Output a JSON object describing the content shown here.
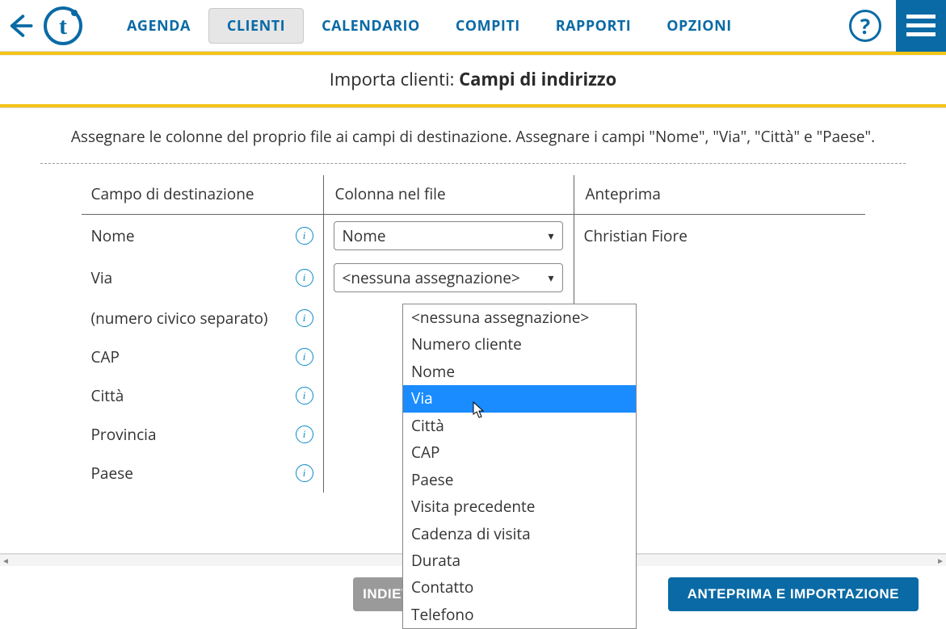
{
  "nav": {
    "items": [
      {
        "label": "AGENDA"
      },
      {
        "label": "CLIENTI"
      },
      {
        "label": "CALENDARIO"
      },
      {
        "label": "COMPITI"
      },
      {
        "label": "RAPPORTI"
      },
      {
        "label": "OPZIONI"
      }
    ],
    "active_index": 1,
    "help_glyph": "?"
  },
  "page_title": {
    "prefix": "Importa clienti: ",
    "main": "Campi di indirizzo"
  },
  "instruction": "Assegnare le colonne del proprio file ai campi di destinazione. Assegnare i campi \"Nome\", \"Via\", \"Città\" e \"Paese\".",
  "table": {
    "headers": {
      "dest": "Campo di destinazione",
      "col": "Colonna nel file",
      "preview": "Anteprima"
    },
    "rows": [
      {
        "dest": "Nome",
        "select_value": "Nome",
        "preview": "Christian Fiore"
      },
      {
        "dest": "Via",
        "select_value": "<nessuna assegnazione>",
        "preview": ""
      },
      {
        "dest": "(numero civico separato)",
        "select_value": "",
        "preview": ""
      },
      {
        "dest": "CAP",
        "select_value": "",
        "preview": ""
      },
      {
        "dest": "Città",
        "select_value": "",
        "preview": ""
      },
      {
        "dest": "Provincia",
        "select_value": "",
        "preview": ""
      },
      {
        "dest": "Paese",
        "select_value": "",
        "preview": ""
      }
    ]
  },
  "dropdown": {
    "options": [
      "<nessuna assegnazione>",
      "Numero cliente",
      "Nome",
      "Via",
      "Città",
      "CAP",
      "Paese",
      "Visita precedente",
      "Cadenza di visita",
      "Durata",
      "Contatto",
      "Telefono"
    ],
    "selected_index": 3
  },
  "footer": {
    "back_label": "INDIETRO",
    "import_label": "ANTEPRIMA E IMPORTAZIONE"
  },
  "info_glyph": "i",
  "scroll": {
    "left": "◄",
    "right": "►"
  }
}
